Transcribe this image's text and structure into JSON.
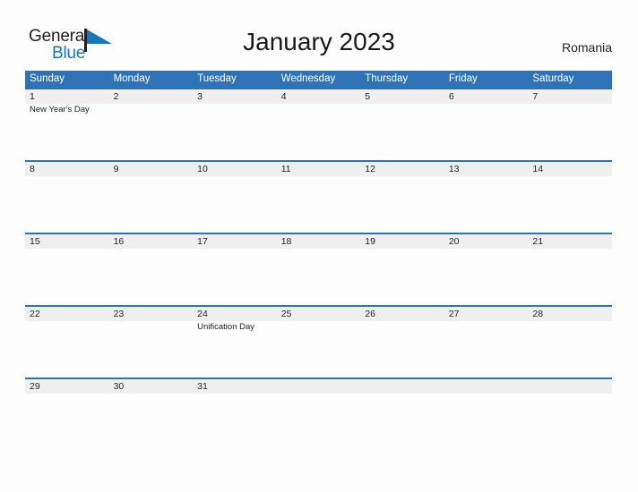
{
  "brand": {
    "name_part1": "General",
    "name_part2": "Blue",
    "flag_icon": "blue-triangle-flag-icon",
    "accent_color": "#1b75bb"
  },
  "header": {
    "title": "January 2023",
    "country": "Romania"
  },
  "colors": {
    "header_band": "#2f72b5",
    "row_divider": "#2f72b5",
    "number_band": "#efefef",
    "page_background": "#fdfdfd",
    "text": "#231f20"
  },
  "calendar": {
    "weekdays": [
      "Sunday",
      "Monday",
      "Tuesday",
      "Wednesday",
      "Thursday",
      "Friday",
      "Saturday"
    ],
    "weeks": [
      {
        "days": [
          {
            "number": "1",
            "event": "New Year's Day"
          },
          {
            "number": "2",
            "event": ""
          },
          {
            "number": "3",
            "event": ""
          },
          {
            "number": "4",
            "event": ""
          },
          {
            "number": "5",
            "event": ""
          },
          {
            "number": "6",
            "event": ""
          },
          {
            "number": "7",
            "event": ""
          }
        ]
      },
      {
        "days": [
          {
            "number": "8",
            "event": ""
          },
          {
            "number": "9",
            "event": ""
          },
          {
            "number": "10",
            "event": ""
          },
          {
            "number": "11",
            "event": ""
          },
          {
            "number": "12",
            "event": ""
          },
          {
            "number": "13",
            "event": ""
          },
          {
            "number": "14",
            "event": ""
          }
        ]
      },
      {
        "days": [
          {
            "number": "15",
            "event": ""
          },
          {
            "number": "16",
            "event": ""
          },
          {
            "number": "17",
            "event": ""
          },
          {
            "number": "18",
            "event": ""
          },
          {
            "number": "19",
            "event": ""
          },
          {
            "number": "20",
            "event": ""
          },
          {
            "number": "21",
            "event": ""
          }
        ]
      },
      {
        "days": [
          {
            "number": "22",
            "event": ""
          },
          {
            "number": "23",
            "event": ""
          },
          {
            "number": "24",
            "event": "Unification Day"
          },
          {
            "number": "25",
            "event": ""
          },
          {
            "number": "26",
            "event": ""
          },
          {
            "number": "27",
            "event": ""
          },
          {
            "number": "28",
            "event": ""
          }
        ]
      },
      {
        "days": [
          {
            "number": "29",
            "event": ""
          },
          {
            "number": "30",
            "event": ""
          },
          {
            "number": "31",
            "event": ""
          },
          {
            "number": "",
            "event": ""
          },
          {
            "number": "",
            "event": ""
          },
          {
            "number": "",
            "event": ""
          },
          {
            "number": "",
            "event": ""
          }
        ]
      }
    ]
  }
}
